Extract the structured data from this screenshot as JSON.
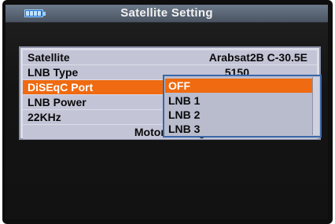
{
  "header": {
    "title": "Satellite Setting",
    "battery_icon": "battery-icon"
  },
  "settings": [
    {
      "label": "Satellite",
      "value": "Arabsat2B C-30.5E"
    },
    {
      "label": "LNB Type",
      "value": "5150"
    },
    {
      "label": "DiSEqC Port",
      "value": "",
      "selected": true
    },
    {
      "label": "LNB Power",
      "value": ""
    },
    {
      "label": "22KHz",
      "value": ""
    },
    {
      "label": "Motor Setting",
      "value": ""
    }
  ],
  "diseqc_dropdown": {
    "options": [
      "OFF",
      "LNB 1",
      "LNB 2",
      "LNB 3"
    ],
    "selected": "OFF"
  },
  "colors": {
    "highlight": "#ef6a10",
    "row_bg": "#c3c4d6",
    "titlebar": "#5b6574",
    "dropdown_border": "#3b66a8"
  }
}
